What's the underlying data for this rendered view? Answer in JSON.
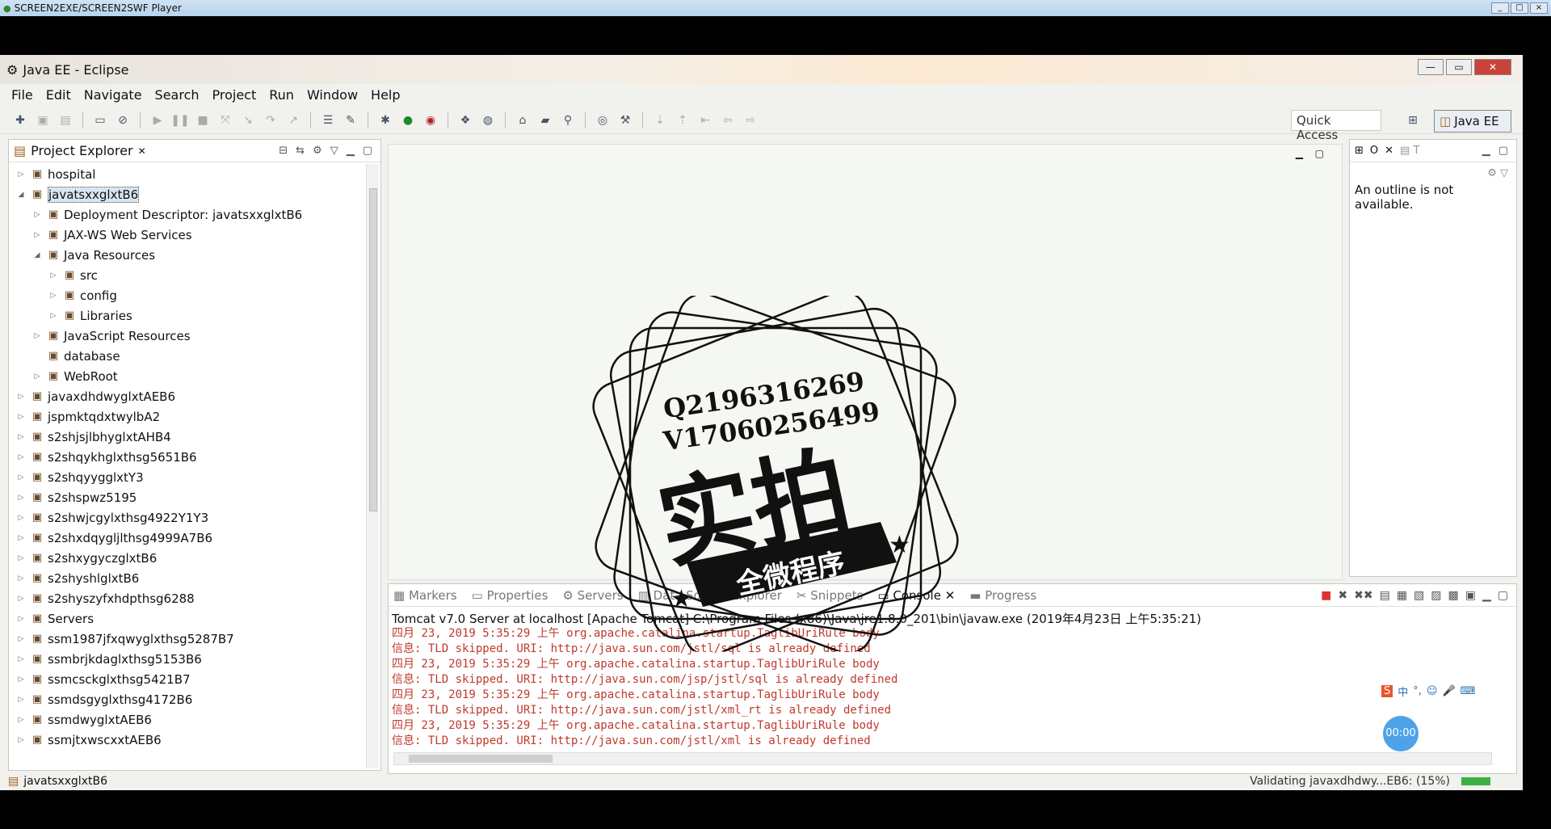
{
  "player": {
    "title": "SCREEN2EXE/SCREEN2SWF Player"
  },
  "window": {
    "title": "Java EE - Eclipse"
  },
  "menu": [
    "File",
    "Edit",
    "Navigate",
    "Search",
    "Project",
    "Run",
    "Window",
    "Help"
  ],
  "toolbar": {
    "quick_access": "Quick Access",
    "perspective": "Java EE"
  },
  "project_explorer": {
    "title": "Project Explorer",
    "items": [
      {
        "label": "hospital",
        "level": 0,
        "tw": "▷",
        "icon": "project-icon"
      },
      {
        "label": "javatsxxglxtB6",
        "level": 0,
        "tw": "◢",
        "icon": "project-icon",
        "selected": true
      },
      {
        "label": "Deployment Descriptor: javatsxxglxtB6",
        "level": 1,
        "tw": "▷",
        "icon": "descriptor-icon"
      },
      {
        "label": "JAX-WS Web Services",
        "level": 1,
        "tw": "▷",
        "icon": "webservice-icon"
      },
      {
        "label": "Java Resources",
        "level": 1,
        "tw": "◢",
        "icon": "java-resources-icon"
      },
      {
        "label": "src",
        "level": 2,
        "tw": "▷",
        "icon": "package-folder-icon"
      },
      {
        "label": "config",
        "level": 2,
        "tw": "▷",
        "icon": "package-folder-icon"
      },
      {
        "label": "Libraries",
        "level": 2,
        "tw": "▷",
        "icon": "library-icon"
      },
      {
        "label": "JavaScript Resources",
        "level": 1,
        "tw": "▷",
        "icon": "js-resources-icon"
      },
      {
        "label": "database",
        "level": 1,
        "tw": "",
        "icon": "folder-icon"
      },
      {
        "label": "WebRoot",
        "level": 1,
        "tw": "▷",
        "icon": "folder-icon"
      },
      {
        "label": "javaxdhdwyglxtAEB6",
        "level": 0,
        "tw": "▷",
        "icon": "project-icon"
      },
      {
        "label": "jspmktqdxtwylbA2",
        "level": 0,
        "tw": "▷",
        "icon": "project-icon"
      },
      {
        "label": "s2shjsjlbhyglxtAHB4",
        "level": 0,
        "tw": "▷",
        "icon": "project-icon"
      },
      {
        "label": "s2shqykhglxthsg5651B6",
        "level": 0,
        "tw": "▷",
        "icon": "project-icon"
      },
      {
        "label": "s2shqyygglxtY3",
        "level": 0,
        "tw": "▷",
        "icon": "project-icon"
      },
      {
        "label": "s2shspwz5195",
        "level": 0,
        "tw": "▷",
        "icon": "project-icon"
      },
      {
        "label": "s2shwjcgylxthsg4922Y1Y3",
        "level": 0,
        "tw": "▷",
        "icon": "project-icon"
      },
      {
        "label": "s2shxdqygljlthsg4999A7B6",
        "level": 0,
        "tw": "▷",
        "icon": "project-icon"
      },
      {
        "label": "s2shxygyczglxtB6",
        "level": 0,
        "tw": "▷",
        "icon": "project-icon"
      },
      {
        "label": "s2shyshlglxtB6",
        "level": 0,
        "tw": "▷",
        "icon": "project-icon"
      },
      {
        "label": "s2shyszyfxhdpthsg6288",
        "level": 0,
        "tw": "▷",
        "icon": "project-icon"
      },
      {
        "label": "Servers",
        "level": 0,
        "tw": "▷",
        "icon": "folder-icon"
      },
      {
        "label": "ssm1987jfxqwyglxthsg5287B7",
        "level": 0,
        "tw": "▷",
        "icon": "project-icon"
      },
      {
        "label": "ssmbrjkdaglxthsg5153B6",
        "level": 0,
        "tw": "▷",
        "icon": "project-icon"
      },
      {
        "label": "ssmcsckglxthsg5421B7",
        "level": 0,
        "tw": "▷",
        "icon": "project-icon"
      },
      {
        "label": "ssmdsgyglxthsg4172B6",
        "level": 0,
        "tw": "▷",
        "icon": "project-icon"
      },
      {
        "label": "ssmdwyglxtAEB6",
        "level": 0,
        "tw": "▷",
        "icon": "project-icon"
      },
      {
        "label": "ssmjtxwscxxtAEB6",
        "level": 0,
        "tw": "▷",
        "icon": "project-icon"
      }
    ]
  },
  "outline": {
    "message": "An outline is not available."
  },
  "bottom_tabs": [
    "Markers",
    "Properties",
    "Servers",
    "Data Source Explorer",
    "Snippets",
    "Console",
    "Progress"
  ],
  "console": {
    "title": "Tomcat v7.0 Server at localhost [Apache Tomcat] C:\\Program Files (x86)\\Java\\jre1.8.0_201\\bin\\javaw.exe (2019年4月23日 上午5:35:21)",
    "lines": [
      "四月 23, 2019 5:35:29 上午 org.apache.catalina.startup.TaglibUriRule body",
      "信息: TLD skipped. URI: http://java.sun.com/jstl/sql is already defined",
      "四月 23, 2019 5:35:29 上午 org.apache.catalina.startup.TaglibUriRule body",
      "信息: TLD skipped. URI: http://java.sun.com/jsp/jstl/sql is already defined",
      "四月 23, 2019 5:35:29 上午 org.apache.catalina.startup.TaglibUriRule body",
      "信息: TLD skipped. URI: http://java.sun.com/jstl/xml_rt is already defined",
      "四月 23, 2019 5:35:29 上午 org.apache.catalina.startup.TaglibUriRule body",
      "信息: TLD skipped. URI: http://java.sun.com/jstl/xml is already defined"
    ]
  },
  "status": {
    "selected": "javatsxxglxtB6",
    "progress": "Validating javaxdhdwy...EB6: (15%)"
  },
  "watermark": {
    "line1": "Q2196316269",
    "line2": "V17060256499",
    "big": "实拍",
    "banner": "全微程序"
  },
  "ime": {
    "label": "中"
  },
  "timer": {
    "value": "00:00"
  }
}
